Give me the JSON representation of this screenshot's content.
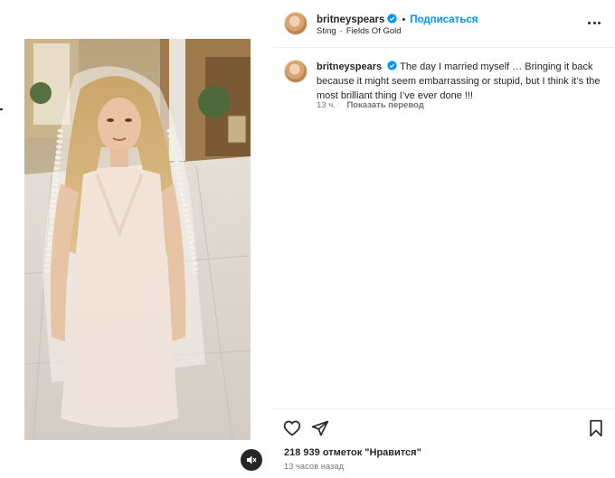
{
  "post": {
    "username": "britneyspears",
    "follow_label": "Подписаться",
    "audio": {
      "artist": "Sting",
      "track": "Fields Of Gold"
    }
  },
  "caption": {
    "username": "britneyspears",
    "text": "The day I married myself … Bringing it back because it might seem embarrassing or stupid, but I think it’s the most brilliant thing I’ve ever done !!!",
    "time": "13 ч.",
    "translate_label": "Показать перевод"
  },
  "footer": {
    "likes": "218 939 отметок \"Нравится\"",
    "time_ago": "13 часов назад"
  },
  "icons": {
    "verified": "verified-badge-icon",
    "more": "more-options-icon",
    "like": "heart-icon",
    "share": "paper-plane-icon",
    "save": "bookmark-icon",
    "mute": "speaker-muted-icon"
  },
  "colors": {
    "accent": "#0095f6",
    "text": "#262626",
    "secondary_text": "#737373",
    "divider": "#efefef"
  }
}
